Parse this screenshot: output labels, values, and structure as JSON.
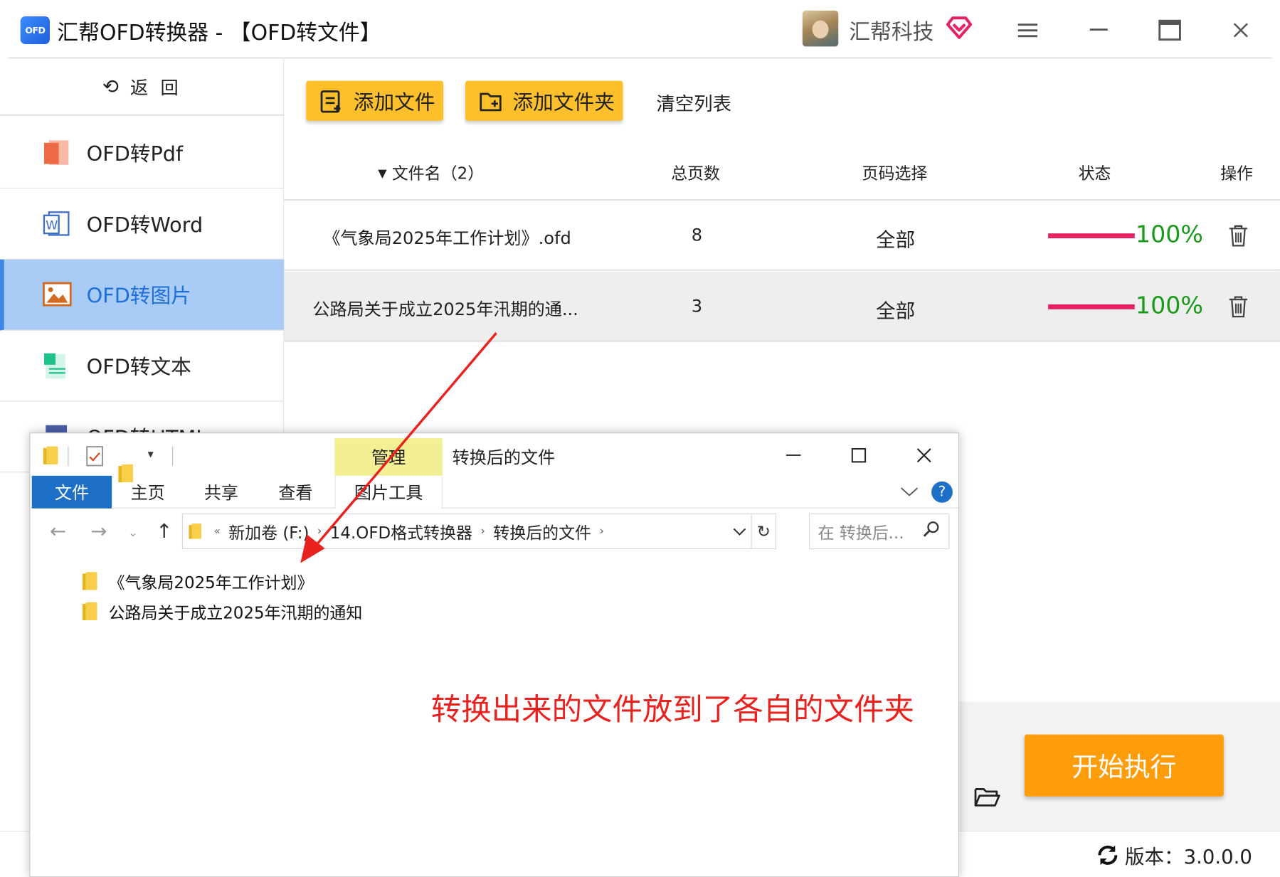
{
  "app": {
    "logo_text": "OFD",
    "title": "汇帮OFD转换器 - 【OFD转文件】",
    "company": "汇帮科技",
    "accent_color": "#fdc02b",
    "active_color": "#a9ccf6"
  },
  "window_controls": {
    "menu_icon": "menu-icon",
    "minimize_icon": "minimize-icon",
    "maximize_icon": "maximize-icon",
    "close_icon": "close-icon"
  },
  "sidebar": {
    "back_label": "返 回",
    "items": [
      {
        "label": "OFD转Pdf",
        "icon": "pdf-icon"
      },
      {
        "label": "OFD转Word",
        "icon": "word-icon"
      },
      {
        "label": "OFD转图片",
        "icon": "image-icon",
        "active": true
      },
      {
        "label": "OFD转文本",
        "icon": "text-icon"
      },
      {
        "label": "OFD转HTML",
        "icon": "html-icon"
      }
    ]
  },
  "toolbar": {
    "add_file": "添加文件",
    "add_folder": "添加文件夹",
    "clear_list": "清空列表"
  },
  "table": {
    "headers": {
      "filename": "文件名（2）",
      "pages": "总页数",
      "page_select": "页码选择",
      "status": "状态",
      "action": "操作"
    },
    "rows": [
      {
        "filename": "《气象局2025年工作计划》.ofd",
        "pages": "8",
        "page_select": "全部",
        "progress": "100%"
      },
      {
        "filename": "公路局关于成立2025年汛期的通...",
        "pages": "3",
        "page_select": "全部",
        "progress": "100%"
      }
    ]
  },
  "start_button": "开始执行",
  "version": "版本：3.0.0.0",
  "explorer": {
    "manage_tab": "管理",
    "title": "转换后的文件",
    "ribbon_tabs": [
      "文件",
      "主页",
      "共享",
      "查看",
      "图片工具"
    ],
    "address": {
      "prefix": "«",
      "segments": [
        "新加卷 (F:)",
        "14.OFD格式转换器",
        "转换后的文件"
      ]
    },
    "search_placeholder": "在 转换后...",
    "items": [
      "《气象局2025年工作计划》",
      "公路局关于成立2025年汛期的通知"
    ]
  },
  "annotation": "转换出来的文件放到了各自的文件夹"
}
